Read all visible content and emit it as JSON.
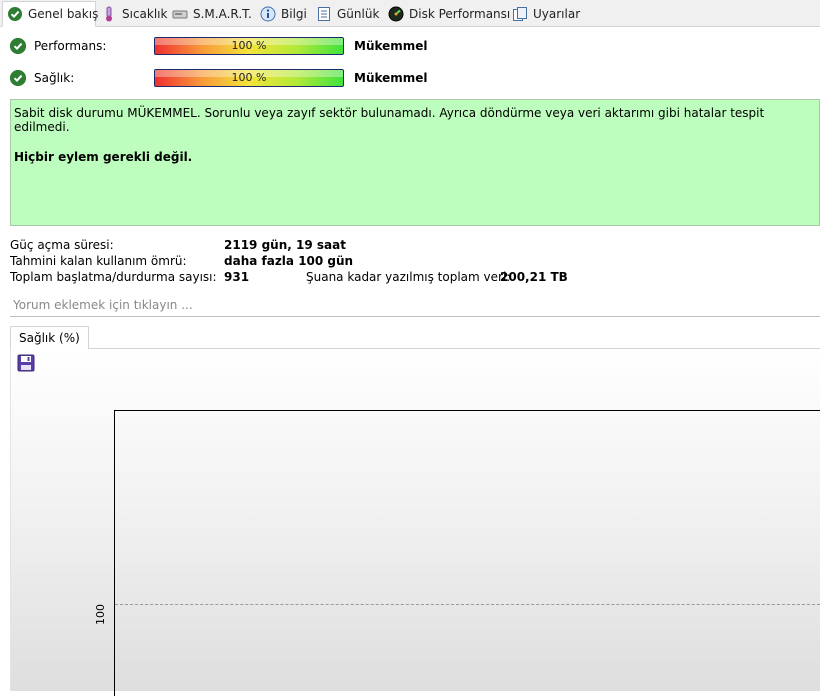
{
  "tabs": [
    {
      "label": "Genel bakış",
      "icon": "check-circle-icon"
    },
    {
      "label": "Sıcaklık",
      "icon": "thermometer-icon"
    },
    {
      "label": "S.M.A.R.T.",
      "icon": "disk-drive-icon"
    },
    {
      "label": "Bilgi",
      "icon": "info-icon"
    },
    {
      "label": "Günlük",
      "icon": "document-icon"
    },
    {
      "label": "Disk Performansı",
      "icon": "gauge-icon"
    },
    {
      "label": "Uyarılar",
      "icon": "alert-pages-icon"
    }
  ],
  "status": {
    "performance": {
      "label": "Performans:",
      "bar_text": "100 %",
      "value_percent": 100,
      "rating": "Mükemmel"
    },
    "health": {
      "label": "Sağlık:",
      "bar_text": "100 %",
      "value_percent": 100,
      "rating": "Mükemmel"
    },
    "message_line1": "Sabit disk durumu MÜKEMMEL. Sorunlu veya zayıf sektör bulunamadı. Ayrıca döndürme veya veri aktarımı gibi hatalar tespit edilmedi.",
    "message_line2": "Hiçbir eylem gerekli değil.",
    "box_color": "#bdfdbd"
  },
  "info": {
    "power_on_label": "Güç açma süresi:",
    "power_on_value": "2119 gün, 19 saat",
    "lifetime_label": "Tahmini kalan kullanım ömrü:",
    "lifetime_value": "daha fazla 100 gün",
    "start_stop_label": "Toplam başlatma/durdurma sayısı:",
    "start_stop_value": "931",
    "written_label": "Şuana kadar yazılmış toplam veri:",
    "written_value": "200,21 TB"
  },
  "comment": {
    "placeholder": "Yorum eklemek için tıklayın ..."
  },
  "chart_tab": {
    "label": "Sağlık (%)"
  },
  "chart_data": {
    "type": "line",
    "title": "",
    "xlabel": "",
    "ylabel": "",
    "y_tick_labels": [
      "100"
    ],
    "grid": true,
    "series": []
  },
  "colors": {
    "check_green": "#2e7d32",
    "bar_border": "#1c2a6b"
  }
}
